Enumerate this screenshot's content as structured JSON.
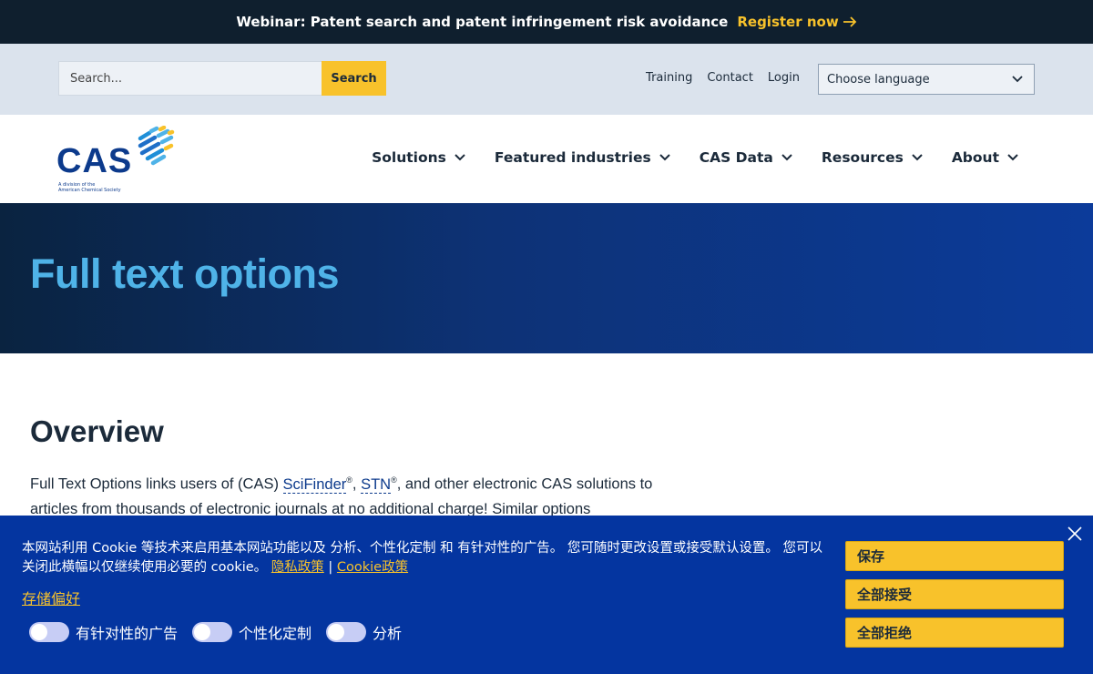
{
  "banner": {
    "text": "Webinar: Patent search and patent infringement risk avoidance",
    "link": "Register now",
    "link_color": "#f8c22b"
  },
  "utility": {
    "search_placeholder": "Search...",
    "search_button": "Search",
    "links": [
      "Training",
      "Contact",
      "Login"
    ],
    "language": "Choose language"
  },
  "logo": {
    "text": "CAS",
    "sub_line1": "A division of the",
    "sub_line2": "American Chemical Society"
  },
  "nav": {
    "items": [
      "Solutions",
      "Featured industries",
      "CAS Data",
      "Resources",
      "About"
    ]
  },
  "hero": {
    "title": "Full text options"
  },
  "content": {
    "heading": "Overview",
    "para_start": "Full Text Options links users of (CAS) ",
    "link1": "SciFinder",
    "comma": ", ",
    "link2": "STN",
    "reg": "®",
    "para_end": ", and other electronic CAS solutions to articles from thousands of electronic journals at no additional charge! Similar options"
  },
  "cookie": {
    "text": "本网站利用 Cookie 等技术来启用基本网站功能以及 分析、个性化定制 和 有针对性的广告。 您可随时更改设置或接受默认设置。 您可以关闭此横幅以仅继续使用必要的 cookie。",
    "privacy_link": "隐私政策",
    "separator": "|",
    "cookie_policy_link": "Cookie政策",
    "prefs_link": "存储偏好",
    "toggles": [
      "有针对性的广告",
      "个性化定制",
      "分析"
    ],
    "buttons": [
      "保存",
      "全部接受",
      "全部拒绝"
    ],
    "background": "#0435a0"
  }
}
